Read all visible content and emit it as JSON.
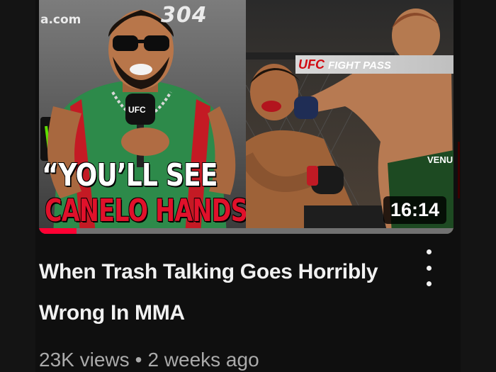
{
  "video": {
    "thumbnail": {
      "backdrop_left": "a.com",
      "backdrop_right": "304",
      "quote_line1": "“YOU’LL SEE",
      "quote_line2": "CANELO HANDS",
      "quote_close": "”",
      "banner_brand": "UFC",
      "banner_rest": "FIGHT PASS",
      "watch_progress": 0.09
    },
    "duration": "16:14",
    "title": "When Trash Talking Goes Horribly Wrong In MMA",
    "views": "23K views",
    "separator": "•",
    "age": "2 weeks ago",
    "menu_icon": "more-vert-icon"
  },
  "colors": {
    "background": "#0f0f0f",
    "title": "#f1f1f1",
    "meta": "#aaaaaa",
    "progress": "#ff0033",
    "quote_red": "#e0112b"
  }
}
